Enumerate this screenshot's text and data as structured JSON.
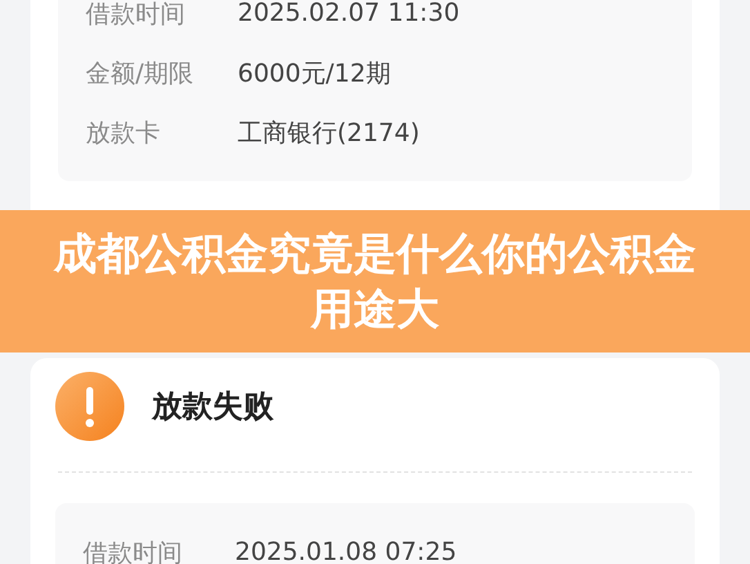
{
  "loan_card": {
    "details": [
      {
        "label": "借款时间",
        "value": "2025.02.07 11:30"
      },
      {
        "label": "金额/期限",
        "value": "6000元/12期"
      },
      {
        "label": "放款卡",
        "value": "工商银行(2174)"
      }
    ]
  },
  "banner": {
    "title": "成都公积金究竟是什么你的公积金用途大"
  },
  "failed_card": {
    "status": "放款失败",
    "details": [
      {
        "label": "借款时间",
        "value": "2025.01.08 07:25"
      }
    ]
  }
}
